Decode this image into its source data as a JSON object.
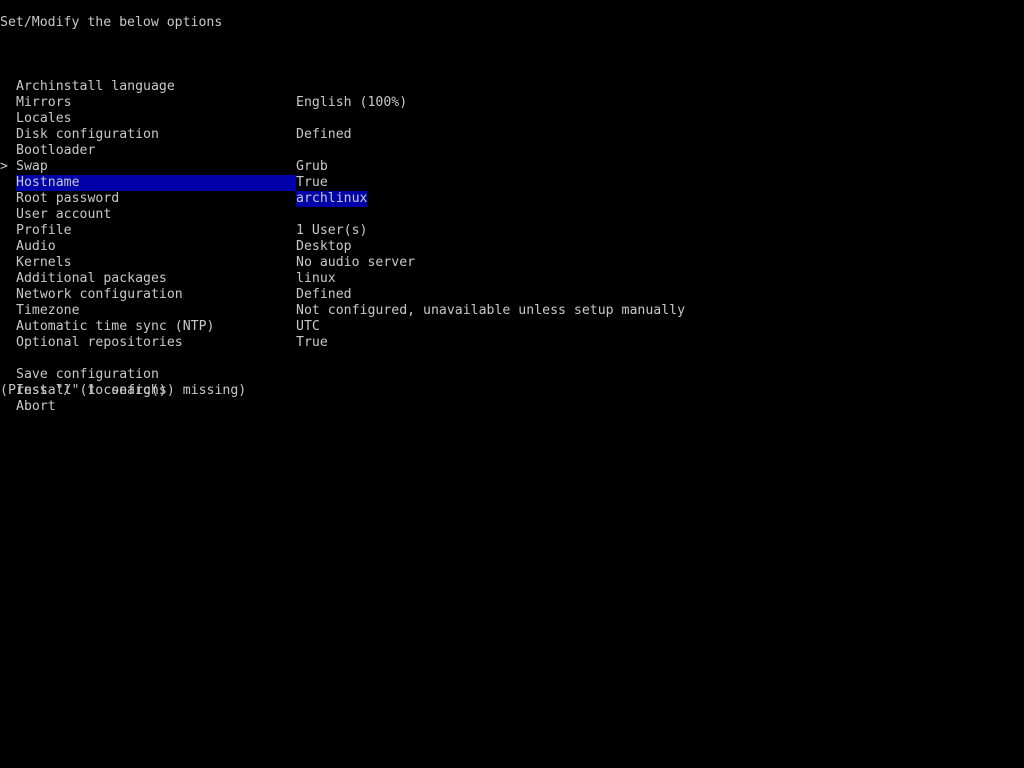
{
  "header": {
    "title": "Set/Modify the below options"
  },
  "menu": {
    "cursor_glyph": ">",
    "items": [
      {
        "label": "Archinstall language",
        "value": "English (100%)"
      },
      {
        "label": "Mirrors",
        "value": ""
      },
      {
        "label": "Locales",
        "value": "Defined"
      },
      {
        "label": "Disk configuration",
        "value": ""
      },
      {
        "label": "Bootloader",
        "value": "Grub"
      },
      {
        "label": "Swap",
        "value": "True"
      },
      {
        "label": "Hostname",
        "value": "archlinux"
      },
      {
        "label": "Root password",
        "value": ""
      },
      {
        "label": "User account",
        "value": "1 User(s)"
      },
      {
        "label": "Profile",
        "value": "Desktop"
      },
      {
        "label": "Audio",
        "value": "No audio server"
      },
      {
        "label": "Kernels",
        "value": "linux"
      },
      {
        "label": "Additional packages",
        "value": "Defined"
      },
      {
        "label": "Network configuration",
        "value": "Not configured, unavailable unless setup manually"
      },
      {
        "label": "Timezone",
        "value": "UTC"
      },
      {
        "label": "Automatic time sync (NTP)",
        "value": "True"
      },
      {
        "label": "Optional repositories",
        "value": ""
      }
    ],
    "actions": [
      {
        "label": "Save configuration"
      },
      {
        "label": "Install (1 config(s) missing)"
      },
      {
        "label": "Abort"
      }
    ]
  },
  "footer": {
    "hint": "(Press \"/\" to search)"
  },
  "colors": {
    "background": "#000000",
    "text": "#c8c8c8",
    "selection": "#0000aa"
  }
}
